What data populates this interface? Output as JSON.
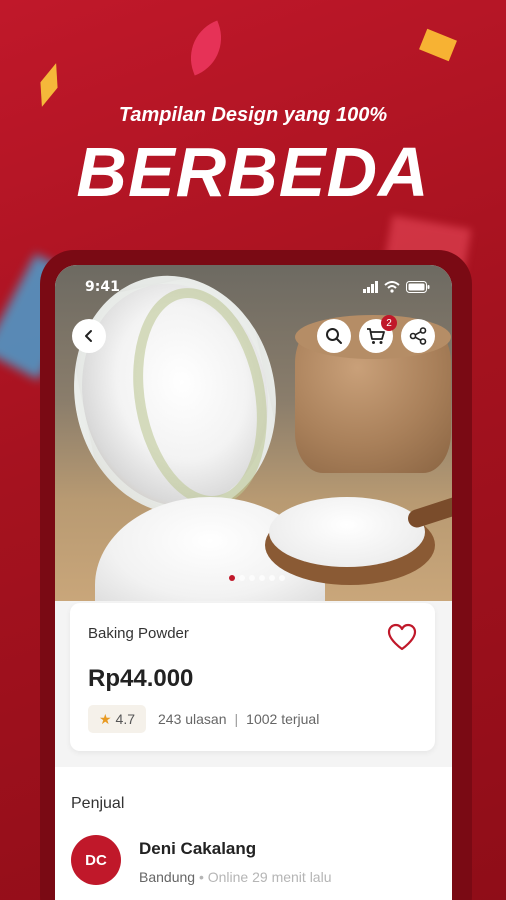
{
  "banner": {
    "subtitle": "Tampilan Design yang 100%",
    "title": "BERBEDA"
  },
  "status_bar": {
    "time": "9:41"
  },
  "top_actions": {
    "cart_count": "2"
  },
  "gallery": {
    "image_count": 6,
    "active_index": 0
  },
  "product": {
    "name": "Baking Powder",
    "price": "Rp44.000",
    "rating": "4.7",
    "reviews": "243 ulasan",
    "separator": "|",
    "sold": "1002 terjual"
  },
  "seller": {
    "section_title": "Penjual",
    "initials": "DC",
    "name": "Deni Cakalang",
    "city": "Bandung",
    "bullet": "•",
    "status": "Online 29 menit lalu"
  },
  "colors": {
    "brand": "#c0182a",
    "star": "#e89a22"
  },
  "icons": [
    "back-arrow-icon",
    "search-icon",
    "cart-icon",
    "share-icon",
    "heart-icon",
    "star-icon",
    "signal-icon",
    "wifi-icon",
    "battery-icon"
  ]
}
